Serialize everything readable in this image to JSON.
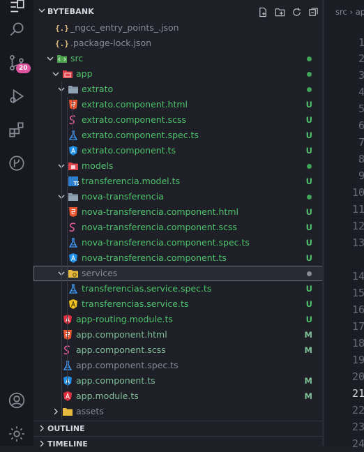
{
  "colors": {
    "accent_green": "#4ec36a",
    "badge": "#e0559f",
    "background": "#1f1f28"
  },
  "activity_bar": {
    "scm_badge": "20"
  },
  "explorer": {
    "title": "BYTEBANK",
    "rows": [
      {
        "label": "_ngcc_entry_points_.json",
        "icon": "json-icon",
        "status": "",
        "color": "grey"
      },
      {
        "label": ".package-lock.json",
        "icon": "json-icon",
        "status": "",
        "color": "grey"
      },
      {
        "label": "src",
        "icon": "folder-src-icon",
        "status": "",
        "color": "green"
      },
      {
        "label": "app",
        "icon": "folder-app-icon",
        "status": "",
        "color": "green"
      },
      {
        "label": "extrato",
        "icon": "folder-icon",
        "status": "",
        "color": "green"
      },
      {
        "label": "extrato.component.html",
        "icon": "html-icon",
        "status": "U",
        "color": "green"
      },
      {
        "label": "extrato.component.scss",
        "icon": "scss-icon",
        "status": "U",
        "color": "green"
      },
      {
        "label": "extrato.component.spec.ts",
        "icon": "test-icon",
        "status": "U",
        "color": "green"
      },
      {
        "label": "extrato.component.ts",
        "icon": "angular-component-icon",
        "status": "U",
        "color": "green"
      },
      {
        "label": "models",
        "icon": "folder-models-icon",
        "status": "",
        "color": "green"
      },
      {
        "label": "transferencia.model.ts",
        "icon": "ts-icon",
        "status": "U",
        "color": "green"
      },
      {
        "label": "nova-transferencia",
        "icon": "folder-icon",
        "status": "",
        "color": "green"
      },
      {
        "label": "nova-transferencia.component.html",
        "icon": "html-icon",
        "status": "U",
        "color": "green"
      },
      {
        "label": "nova-transferencia.component.scss",
        "icon": "scss-icon",
        "status": "U",
        "color": "green"
      },
      {
        "label": "nova-transferencia.component.spec.ts",
        "icon": "test-icon",
        "status": "U",
        "color": "green"
      },
      {
        "label": "nova-transferencia.component.ts",
        "icon": "angular-component-icon",
        "status": "U",
        "color": "green"
      },
      {
        "label": "services",
        "icon": "folder-services-icon",
        "status": "",
        "color": "grey"
      },
      {
        "label": "transferencias.service.spec.ts",
        "icon": "test-icon",
        "status": "U",
        "color": "green"
      },
      {
        "label": "transferencias.service.ts",
        "icon": "angular-service-icon",
        "status": "U",
        "color": "green"
      },
      {
        "label": "app-routing.module.ts",
        "icon": "angular-module-icon",
        "status": "U",
        "color": "green"
      },
      {
        "label": "app.component.html",
        "icon": "html-icon",
        "status": "M",
        "color": "olive"
      },
      {
        "label": "app.component.scss",
        "icon": "scss-icon",
        "status": "M",
        "color": "olive"
      },
      {
        "label": "app.component.spec.ts",
        "icon": "test-icon",
        "status": "",
        "color": "grey"
      },
      {
        "label": "app.component.ts",
        "icon": "angular-component-icon",
        "status": "M",
        "color": "olive"
      },
      {
        "label": "app.module.ts",
        "icon": "angular-module-icon",
        "status": "M",
        "color": "olive"
      },
      {
        "label": "assets",
        "icon": "folder-assets-icon",
        "status": "",
        "color": "grey"
      }
    ],
    "outline_label": "OUTLINE",
    "timeline_label": "TIMELINE"
  },
  "editor": {
    "breadcrumb": "src › ap",
    "line_numbers": [
      "1",
      "2",
      "3",
      "4",
      "5",
      "6",
      "7",
      "8",
      "9",
      "10",
      "11",
      "12",
      "13",
      "14",
      "15",
      "16",
      "17",
      "18",
      "19",
      "20",
      "21",
      "22",
      "23",
      "24"
    ],
    "active_line": "21"
  }
}
